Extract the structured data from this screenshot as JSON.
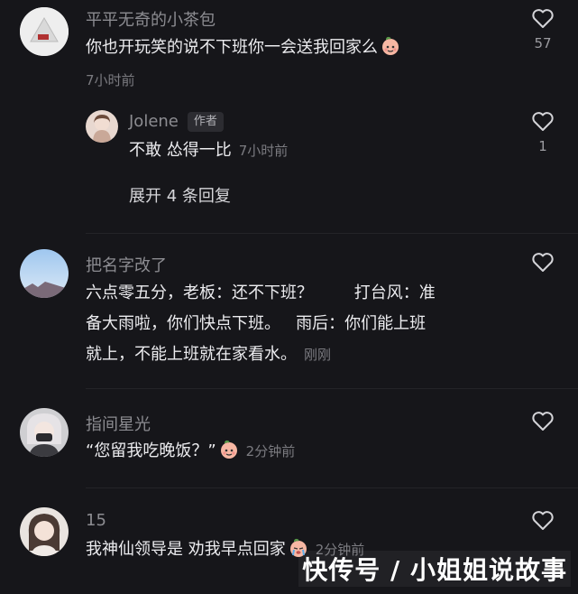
{
  "comments": [
    {
      "username": "平平无奇的小茶包",
      "text": "你也开玩笑的说不下班你一会送我回家么",
      "time": "7小时前",
      "likes": "57",
      "emoji": "peach-face-emoji",
      "reply": {
        "username": "Jolene",
        "badge": "作者",
        "text": "不敢 怂得一比",
        "time": "7小时前",
        "likes": "1"
      },
      "expand_label": "展开 4 条回复"
    },
    {
      "username": "把名字改了",
      "lines": [
        "六点零五分，老板：还不下班？        打台风：准",
        "备大雨啦，你们快点下班。   雨后：你们能上班",
        "就上，不能上班就在家看水。"
      ],
      "time": "刚刚",
      "likes": ""
    },
    {
      "username": "指间星光",
      "text": "“您留我吃晚饭？”",
      "time": "2分钟前",
      "likes": "",
      "emoji": "peach-face-emoji"
    },
    {
      "username": "15",
      "text": "我神仙领导是 劝我早点回家",
      "time": "2分钟前",
      "likes": "",
      "emoji": "crying-peach-emoji"
    }
  ],
  "watermark": "快传号 / 小姐姐说故事",
  "colors": {
    "background": "#16161a",
    "username": "#8c8c91",
    "text": "#ececef",
    "time": "#7b7b80"
  }
}
